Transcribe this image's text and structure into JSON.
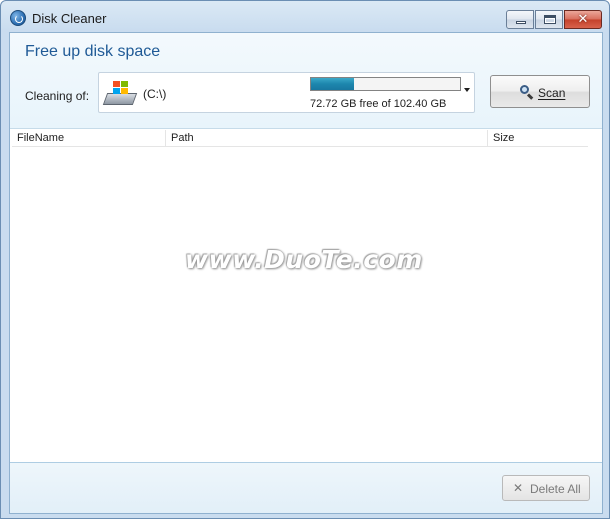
{
  "window": {
    "title": "Disk Cleaner",
    "close_glyph": "✕"
  },
  "header": {
    "heading": "Free up disk space",
    "cleaning_label": "Cleaning of:"
  },
  "drive": {
    "name": "(C:\\)",
    "free_text": "72.72 GB free of 102.40 GB",
    "used_fraction": 0.29
  },
  "scan": {
    "label": "Scan"
  },
  "table": {
    "columns": [
      "FileName",
      "Path",
      "Size"
    ],
    "rows": []
  },
  "watermark": "www.DuoTe.com",
  "footer": {
    "delete_all_label": "Delete All",
    "delete_icon_glyph": "✕"
  },
  "colors": {
    "heading": "#1f5a96",
    "progress": "#1d86ad"
  }
}
